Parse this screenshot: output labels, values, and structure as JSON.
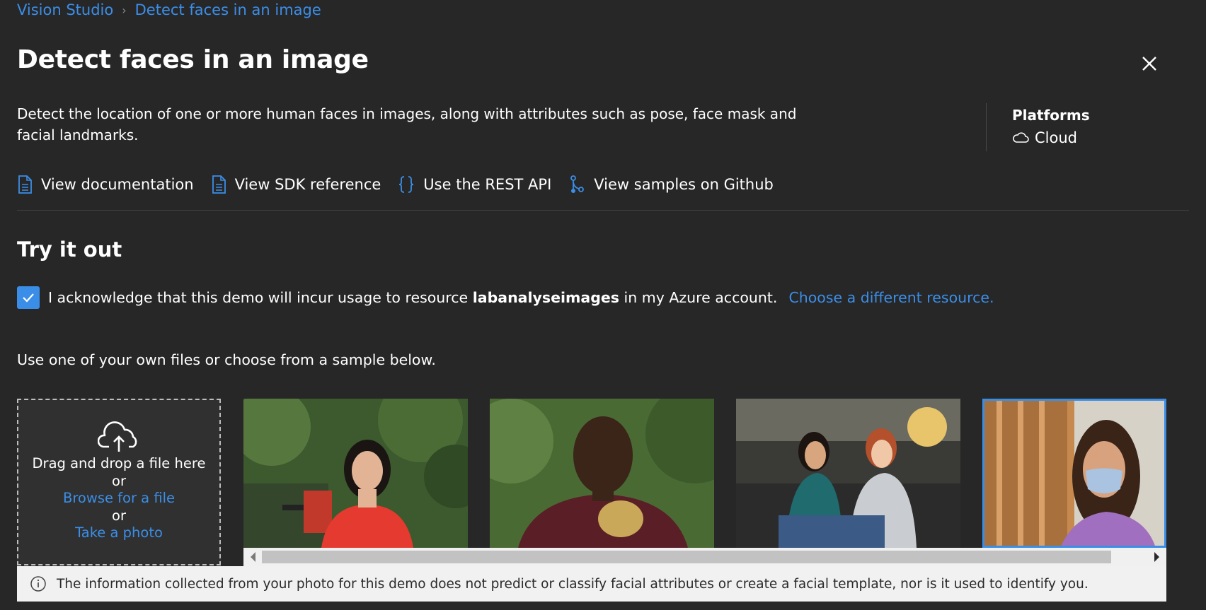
{
  "breadcrumb": {
    "items": [
      "Vision Studio",
      "Detect faces in an image"
    ],
    "separator": "›"
  },
  "title": "Detect faces in an image",
  "close_icon": "close-icon",
  "description": "Detect the location of one or more human faces in images, along with attributes such as pose, face mask and facial landmarks.",
  "platforms": {
    "heading": "Platforms",
    "value": "Cloud",
    "icon": "cloud-icon"
  },
  "links": [
    {
      "label": "View documentation",
      "icon": "document-icon"
    },
    {
      "label": "View SDK reference",
      "icon": "document-icon"
    },
    {
      "label": "Use the REST API",
      "icon": "braces-icon"
    },
    {
      "label": "View samples on Github",
      "icon": "branch-icon"
    }
  ],
  "try_title": "Try it out",
  "acknowledge": {
    "checked": true,
    "text_before": "I acknowledge that this demo will incur usage to resource",
    "resource": "labanalyseimages",
    "text_after": "in my Azure account.",
    "link": "Choose a different resource."
  },
  "use_text": "Use one of your own files or choose from a sample below.",
  "dropzone": {
    "icon": "cloud-upload-icon",
    "drag_text": "Drag and drop a file here",
    "or_1": "or",
    "browse": "Browse for a file",
    "or_2": "or",
    "take_photo": "Take a photo"
  },
  "samples": [
    {
      "name": "sample-woman-red-dress",
      "selected": false
    },
    {
      "name": "sample-man-holding-mask",
      "selected": false
    },
    {
      "name": "sample-two-women-office",
      "selected": false
    },
    {
      "name": "sample-woman-face-mask",
      "selected": true
    }
  ],
  "info": {
    "icon": "info-icon",
    "text": "The information collected from your photo for this demo does not predict or classify facial attributes or create a facial template, nor is it used to identify you."
  },
  "colors": {
    "background": "#272727",
    "accent": "#3b8ee8",
    "info_bar": "#f1f1f1"
  }
}
